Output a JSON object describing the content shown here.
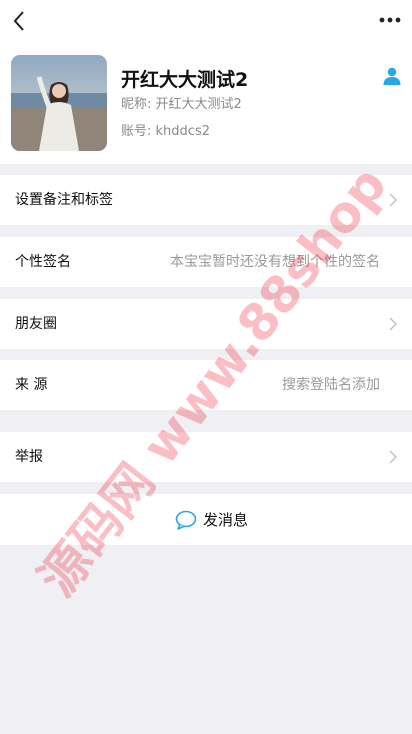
{
  "profile": {
    "name": "开红大大测试2",
    "nickname_label": "昵称:",
    "nickname": "开红大大测试2",
    "account_label": "账号:",
    "account": "khddcs2"
  },
  "rows": {
    "remark": {
      "label": "设置备注和标签"
    },
    "signature": {
      "label": "个性签名",
      "value": "本宝宝暂时还没有想到个性的签名"
    },
    "moments": {
      "label": "朋友圈"
    },
    "source": {
      "label": "来 源",
      "value": "搜索登陆名添加"
    },
    "report": {
      "label": "举报"
    }
  },
  "actions": {
    "send_message": "发消息"
  },
  "watermark": "源码网 www.88shop",
  "icons": {
    "back": "chevron-left-icon",
    "more": "more-dots-icon",
    "user": "user-icon",
    "chevron": "chevron-right-icon",
    "chat": "chat-bubble-icon"
  },
  "colors": {
    "background": "#efeff4",
    "accent": "#2aa6e6",
    "muted_text": "#8a8a8a",
    "watermark": "#f0283c"
  }
}
